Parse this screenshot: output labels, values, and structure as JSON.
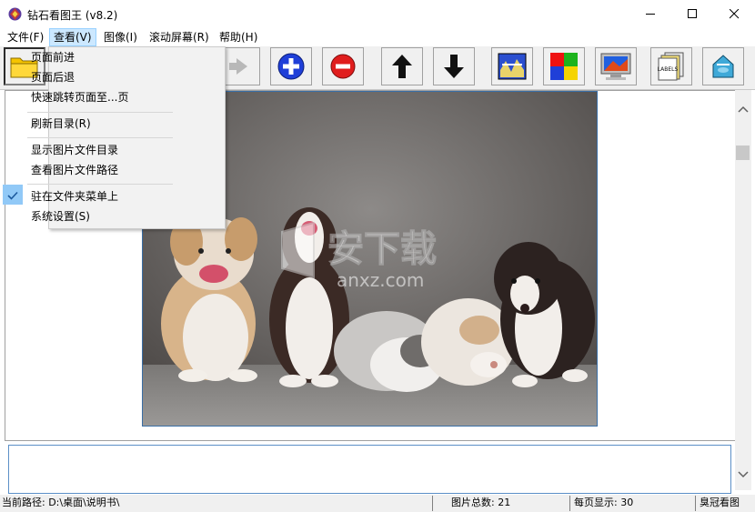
{
  "window": {
    "title": "钻石看图王 (v8.2)"
  },
  "menubar": {
    "items": [
      {
        "label": "文件(F)"
      },
      {
        "label": "查看(V)"
      },
      {
        "label": "图像(I)"
      },
      {
        "label": "滚动屏幕(R)"
      },
      {
        "label": "帮助(H)"
      }
    ]
  },
  "view_menu": {
    "items": [
      {
        "label": "页面前进"
      },
      {
        "label": "页面后退"
      },
      {
        "label": "快速跳转页面至...页"
      },
      {
        "label": "刷新目录(R)"
      },
      {
        "label": "显示图片文件目录"
      },
      {
        "label": "查看图片文件路径"
      },
      {
        "label": "驻在文件夹菜单上",
        "checked": true
      },
      {
        "label": "系统设置(S)"
      }
    ]
  },
  "toolbar": {
    "buttons": [
      {
        "icon": "folder-icon"
      },
      {
        "icon": "arrow-right-icon"
      },
      {
        "icon": "zoom-in-icon"
      },
      {
        "icon": "zoom-out-icon"
      },
      {
        "icon": "arrow-up-icon"
      },
      {
        "icon": "arrow-down-icon"
      },
      {
        "icon": "wallpaper-icon"
      },
      {
        "icon": "color-grid-icon"
      },
      {
        "icon": "monitor-icon"
      },
      {
        "icon": "labels-icon"
      },
      {
        "icon": "paint-bucket-icon"
      }
    ],
    "labels_text": "LABELS"
  },
  "watermark": {
    "text_cn": "安下载",
    "text_en": "anxz.com"
  },
  "statusbar": {
    "path": "当前路径: D:\\桌面\\说明书\\",
    "total": "图片总数: 21",
    "per_page": "每页显示: 30",
    "brand": "臭冠看图"
  },
  "colors": {
    "menu_highlight": "#cce8ff",
    "check_highlight": "#91c9f7",
    "photo_border": "#3a6ea5"
  }
}
